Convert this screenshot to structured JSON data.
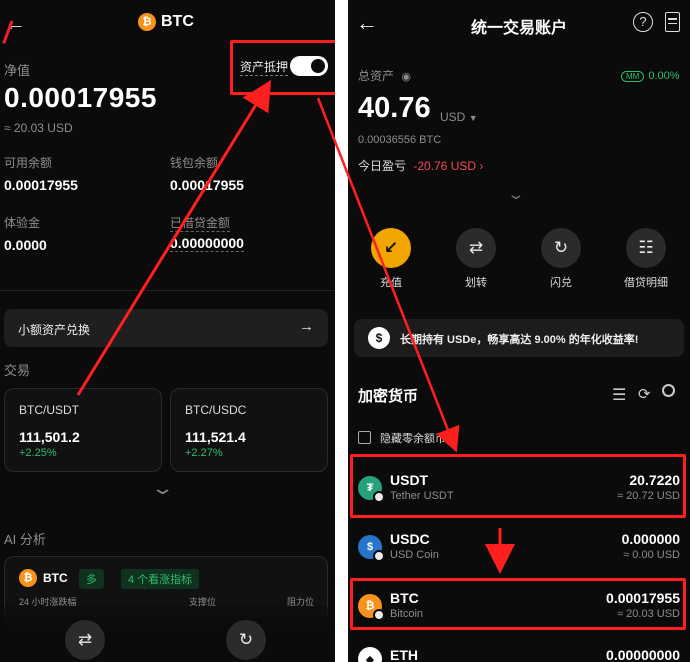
{
  "left": {
    "title": "BTC",
    "net_value_label": "净值",
    "collateral_label": "资产抵押",
    "collateral_enabled": true,
    "net_value": "0.00017955",
    "net_value_usd": "≈ 20.03 USD",
    "available_label": "可用余额",
    "available_value": "0.00017955",
    "wallet_label": "钱包余额",
    "wallet_value": "0.00017955",
    "trial_label": "体验金",
    "trial_value": "0.0000",
    "loan_label": "已借贷金额",
    "loan_value": "0.00000000",
    "small_convert_label": "小额资产兑换",
    "trade_label": "交易",
    "pairs": [
      {
        "name": "BTC/USDT",
        "price": "111,501.2",
        "change": "+2.25%"
      },
      {
        "name": "BTC/USDC",
        "price": "111,521.4",
        "change": "+2.27%"
      }
    ],
    "ai_label": "AI 分析",
    "ai_coin": "BTC",
    "ai_tag1": "多",
    "ai_tag2": "4 个看涨指标",
    "ai_col1": "24 小时涨跌幅",
    "ai_col2": "支撑位",
    "ai_col3": "阻力位"
  },
  "right": {
    "title": "统一交易账户",
    "total_label": "总资产",
    "mm_badge": "MM",
    "mm_value": "0.00%",
    "total_value": "40.76",
    "total_unit": "USD",
    "total_btc": "0.00036556 BTC",
    "pnl_label": "今日盈亏",
    "pnl_value": "-20.76 USD",
    "actions": [
      {
        "label": "充值",
        "icon": "deposit-arrow-icon"
      },
      {
        "label": "划转",
        "icon": "transfer-icon"
      },
      {
        "label": "闪兑",
        "icon": "swap-icon"
      },
      {
        "label": "借贷明细",
        "icon": "loan-icon"
      }
    ],
    "promo": "长期持有 USDe，畅享高达 9.00% 的年化收益率!",
    "crypto_label": "加密货币",
    "hide_small_label": "隐藏零余额币种",
    "coins": [
      {
        "symbol": "USDT",
        "name": "Tether USDT",
        "amount": "20.7220",
        "usd": "≈ 20.72 USD",
        "color": "#26a17b"
      },
      {
        "symbol": "USDC",
        "name": "USD Coin",
        "amount": "0.000000",
        "usd": "≈ 0.00 USD",
        "color": "#2775ca"
      },
      {
        "symbol": "BTC",
        "name": "Bitcoin",
        "amount": "0.00017955",
        "usd": "≈ 20.03 USD",
        "color": "#f7931a"
      },
      {
        "symbol": "ETH",
        "name": "",
        "amount": "0.00000000",
        "usd": "",
        "color": "#ffffff"
      }
    ]
  }
}
